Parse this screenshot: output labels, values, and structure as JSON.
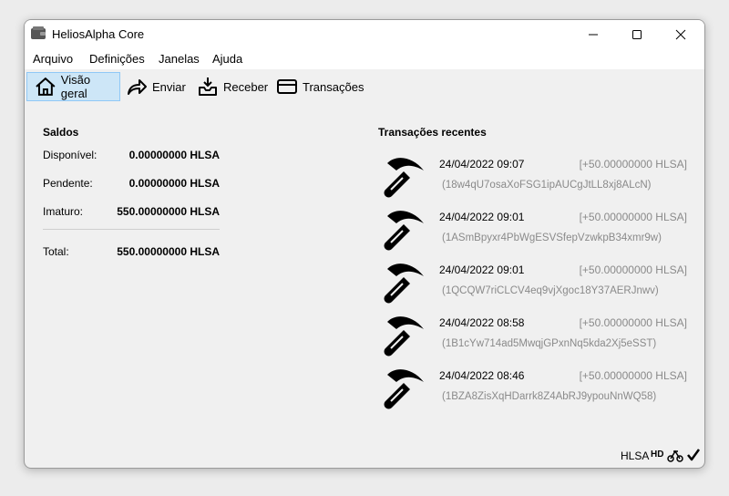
{
  "window": {
    "title": "HeliosAlpha Core"
  },
  "menu": [
    "Arquivo",
    "Definições",
    "Janelas",
    "Ajuda"
  ],
  "toolbar": {
    "overview": "Visão geral",
    "send": "Enviar",
    "receive": "Receber",
    "transactions": "Transações"
  },
  "balances": {
    "title": "Saldos",
    "available_label": "Disponível:",
    "available_value": "0.00000000 HLSA",
    "pending_label": "Pendente:",
    "pending_value": "0.00000000 HLSA",
    "immature_label": "Imaturo:",
    "immature_value": "550.00000000 HLSA",
    "total_label": "Total:",
    "total_value": "550.00000000 HLSA"
  },
  "recent": {
    "title": "Transações recentes",
    "items": [
      {
        "date": "24/04/2022 09:07",
        "amount": "[+50.00000000 HLSA]",
        "address": "(18w4qU7osaXoFSG1ipAUCgJtLL8xj8ALcN)",
        "icon": "mined-pickaxe-icon"
      },
      {
        "date": "24/04/2022 09:01",
        "amount": "[+50.00000000 HLSA]",
        "address": "(1ASmBpyxr4PbWgESVSfepVzwkpB34xmr9w)",
        "icon": "mined-pickaxe-icon"
      },
      {
        "date": "24/04/2022 09:01",
        "amount": "[+50.00000000 HLSA]",
        "address": "(1QCQW7riCLCV4eq9vjXgoc18Y37AERJnwv)",
        "icon": "mined-pickaxe-icon"
      },
      {
        "date": "24/04/2022 08:58",
        "amount": "[+50.00000000 HLSA]",
        "address": "(1B1cYw714ad5MwqjGPxnNq5kda2Xj5eSST)",
        "icon": "mined-pickaxe-icon"
      },
      {
        "date": "24/04/2022 08:46",
        "amount": "[+50.00000000 HLSA]",
        "address": "(1BZA8ZisXqHDarrk8Z4AbRJ9ypouNnWQ58)",
        "icon": "mined-pickaxe-icon"
      }
    ]
  },
  "status": {
    "unit": "HLSA",
    "hd": "HD"
  }
}
